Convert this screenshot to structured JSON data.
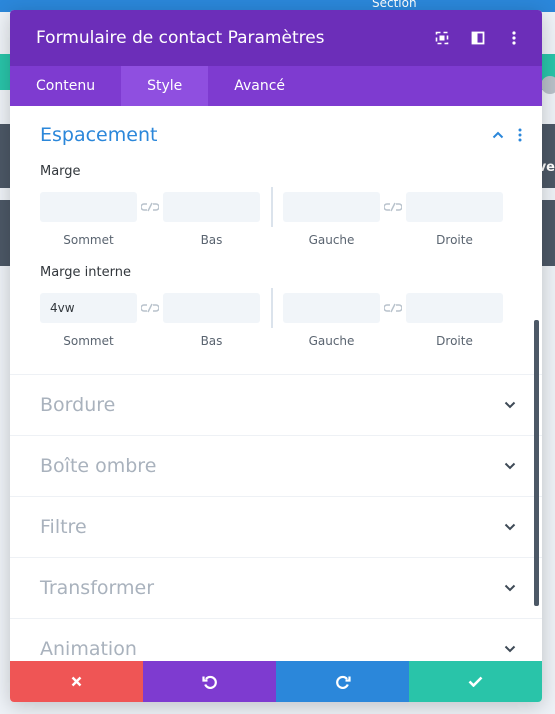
{
  "background": {
    "section_label": "Section",
    "right_fragment": "ive"
  },
  "modal": {
    "title": "Formulaire de contact Paramètres",
    "header_icons": [
      "fullscreen-icon",
      "sidebar-layout-icon",
      "more-vertical-icon"
    ],
    "tabs": [
      {
        "label": "Contenu",
        "active": false
      },
      {
        "label": "Style",
        "active": true
      },
      {
        "label": "Avancé",
        "active": false
      }
    ]
  },
  "spacing": {
    "title": "Espacement",
    "margin": {
      "label": "Marge",
      "values": {
        "top": "",
        "bottom": "",
        "left": "",
        "right": ""
      },
      "sublabels": [
        "Sommet",
        "Bas",
        "Gauche",
        "Droite"
      ]
    },
    "padding": {
      "label": "Marge interne",
      "values": {
        "top": "4vw",
        "bottom": "",
        "left": "",
        "right": ""
      },
      "sublabels": [
        "Sommet",
        "Bas",
        "Gauche",
        "Droite"
      ]
    }
  },
  "collapsed_sections": [
    "Bordure",
    "Boîte ombre",
    "Filtre",
    "Transformer",
    "Animation"
  ],
  "footer": {
    "buttons": [
      {
        "name": "cancel",
        "color": "#ef5555"
      },
      {
        "name": "undo",
        "color": "#7e3bd0"
      },
      {
        "name": "redo",
        "color": "#2b87da"
      },
      {
        "name": "save",
        "color": "#29c4a9"
      }
    ]
  },
  "colors": {
    "header": "#6c2eb9",
    "tabs": "#7e3bd0",
    "accent_blue": "#2b87da",
    "teal": "#29c4a9"
  }
}
